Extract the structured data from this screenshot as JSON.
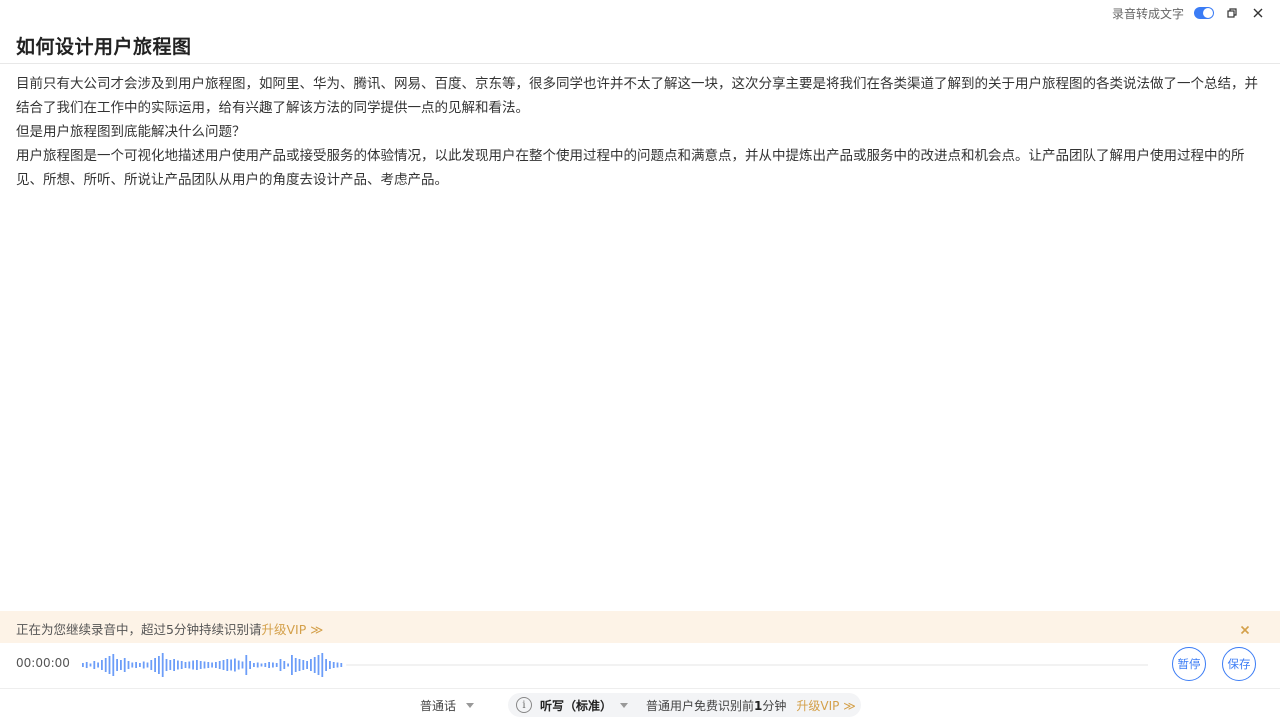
{
  "topbar": {
    "toggle_label": "录音转成文字",
    "toggle_on": true
  },
  "doc": {
    "title": "如何设计用户旅程图",
    "paragraphs": [
      "目前只有大公司才会涉及到用户旅程图，如阿里、华为、腾讯、网易、百度、京东等，很多同学也许并不太了解这一块，这次分享主要是将我们在各类渠道了解到的关于用户旅程图的各类说法做了一个总结，并结合了我们在工作中的实际运用，给有兴趣了解该方法的同学提供一点的见解和看法。",
      "但是用户旅程图到底能解决什么问题？",
      "用户旅程图是一个可视化地描述用户使用产品或接受服务的体验情况，以此发现用户在整个使用过程中的问题点和满意点，并从中提炼出产品或服务中的改进点和机会点。让产品团队了解用户使用过程中的所见、所想、所听、所说让产品团队从用户的角度去设计产品、考虑产品。"
    ]
  },
  "banner": {
    "text": "正在为您继续录音中，超过5分钟持续识别请",
    "link": "升级VIP ≫"
  },
  "recorder": {
    "timer": "00:00:00",
    "pause_label": "暂停",
    "save_label": "保存"
  },
  "bottom": {
    "language": "普通话",
    "mode": "听写（标准）",
    "quota_prefix": "普通用户免费识别前",
    "quota_num": "1",
    "quota_suffix": "分钟",
    "upgrade": "升级VIP ≫"
  },
  "colors": {
    "accent": "#3b7cf5",
    "vip": "#d4a04a",
    "banner_bg": "#fdf3e7"
  }
}
